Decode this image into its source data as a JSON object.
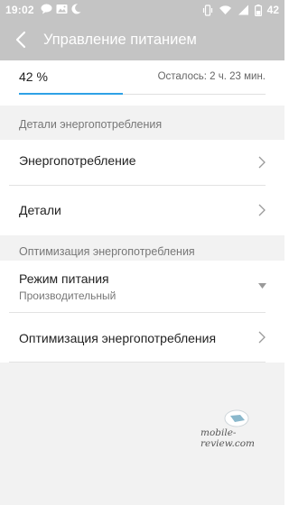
{
  "status_bar": {
    "time": "19:02",
    "battery": "42",
    "left_icons": [
      "chat-icon",
      "image-icon",
      "moon-icon"
    ],
    "right_icons": [
      "vibrate-icon",
      "wifi-icon",
      "signal-icon",
      "battery-icon"
    ]
  },
  "app_bar": {
    "title": "Управление питанием"
  },
  "battery": {
    "percent_label": "42 %",
    "remaining_label": "Осталось: 2 ч. 23 мин.",
    "level": 0.42,
    "accent": "#2ea1e6"
  },
  "sections": [
    {
      "header": "Детали энергопотребления",
      "items": [
        {
          "label": "Энергопотребление",
          "icon": "chevron-right-icon"
        },
        {
          "label": "Детали",
          "icon": "chevron-right-icon"
        }
      ]
    },
    {
      "header": "Оптимизация энергопотребления",
      "items": [
        {
          "label": "Режим питания",
          "value": "Производительный",
          "icon": "dropdown-triangle-icon"
        },
        {
          "label": "Оптимизация энергопотребления",
          "icon": "chevron-right-icon"
        }
      ]
    }
  ],
  "watermark": {
    "text": "mobile-review.com"
  },
  "colors": {
    "app_bar": "#c4c4c4",
    "section_bg": "#f2f2f2",
    "accent": "#2ea1e6"
  }
}
